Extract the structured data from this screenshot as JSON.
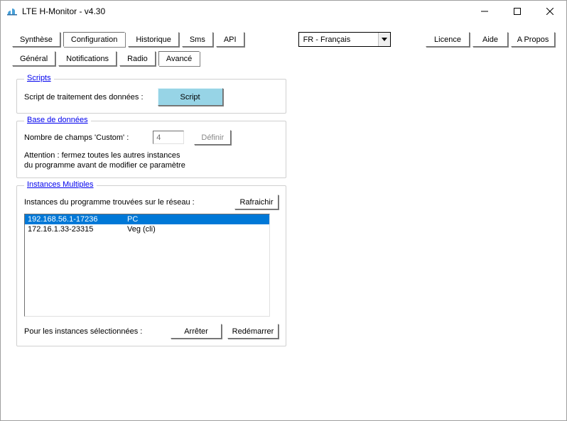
{
  "title": "LTE H-Monitor - v4.30",
  "win_controls": {
    "min": "—",
    "max": "☐",
    "close": "✕"
  },
  "tabs_top": {
    "synthese": "Synthèse",
    "configuration": "Configuration",
    "historique": "Historique",
    "sms": "Sms",
    "api": "API"
  },
  "lang": {
    "value": "FR - Français"
  },
  "buttons_right": {
    "licence": "Licence",
    "aide": "Aide",
    "apropos": "A Propos"
  },
  "tabs_sub": {
    "general": "Général",
    "notifications": "Notifications",
    "radio": "Radio",
    "avance": "Avancé"
  },
  "scripts": {
    "legend": "Scripts",
    "label": "Script de traitement des données :",
    "button": "Script"
  },
  "db": {
    "legend": "Base de données",
    "label": "Nombre de champs 'Custom' :",
    "value": "4",
    "define": "Définir",
    "warn1": "Attention : fermez toutes les autres instances",
    "warn2": "du programme avant de modifier ce paramètre"
  },
  "instances": {
    "legend": "Instances Multiples",
    "found_label": "Instances du programme trouvées sur le réseau :",
    "refresh": "Rafraichir",
    "rows": [
      {
        "addr": "192.168.56.1-17236",
        "name": "PC"
      },
      {
        "addr": "172.16.1.33-23315",
        "name": "Veg (cli)"
      }
    ],
    "selected_label": "Pour les instances sélectionnées  :",
    "stop": "Arrêter",
    "restart": "Redémarrer"
  }
}
